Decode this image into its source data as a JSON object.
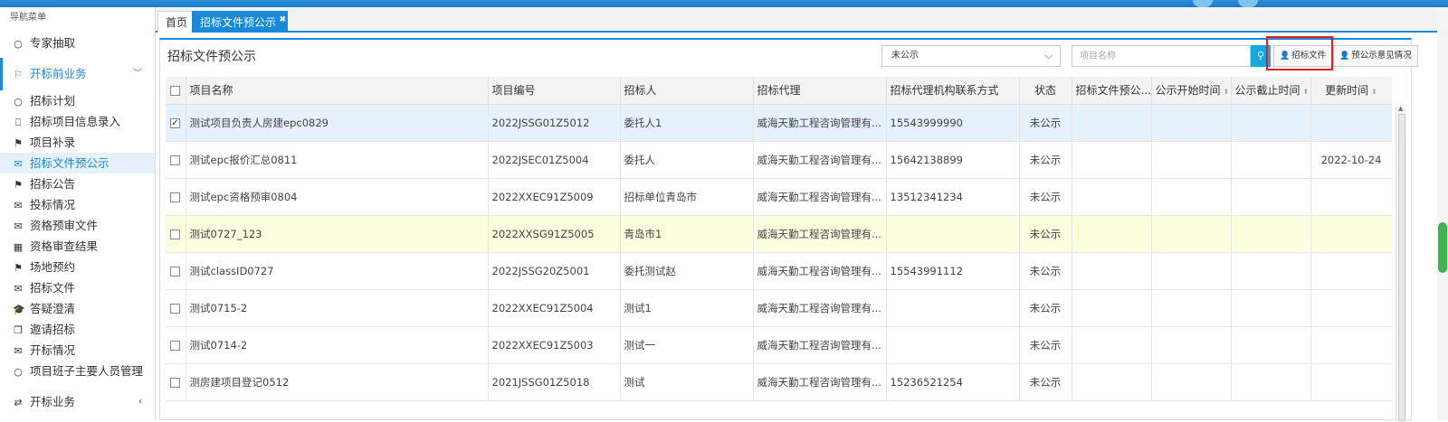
{
  "sidebar": {
    "title": "导航菜单",
    "top_item": {
      "label": "专家抽取",
      "icon": "circle-icon"
    },
    "group": {
      "label": "开标前业务",
      "icon": "flag-outline-icon",
      "expanded": true
    },
    "items": [
      {
        "label": "招标计划",
        "icon": "circle-icon"
      },
      {
        "label": "招标项目信息录入",
        "icon": "bookmark-icon"
      },
      {
        "label": "项目补录",
        "icon": "flag-icon"
      },
      {
        "label": "招标文件预公示",
        "icon": "envelope-icon",
        "active": true
      },
      {
        "label": "招标公告",
        "icon": "flag-icon"
      },
      {
        "label": "投标情况",
        "icon": "envelope-icon"
      },
      {
        "label": "资格预审文件",
        "icon": "envelope-icon"
      },
      {
        "label": "资格审查结果",
        "icon": "calendar-icon"
      },
      {
        "label": "场地预约",
        "icon": "flag-icon"
      },
      {
        "label": "招标文件",
        "icon": "envelope-icon"
      },
      {
        "label": "答疑澄清",
        "icon": "graduation-cap-icon"
      },
      {
        "label": "邀请招标",
        "icon": "copy-icon"
      },
      {
        "label": "开标情况",
        "icon": "envelope-icon"
      },
      {
        "label": "项目班子主要人员管理",
        "icon": "circle-icon"
      }
    ],
    "bottom_group": {
      "label": "开标业务",
      "icon": "exchange-icon"
    }
  },
  "tabs": [
    {
      "label": "首页",
      "active": false
    },
    {
      "label": "招标文件预公示",
      "active": true
    }
  ],
  "panel": {
    "title": "招标文件预公示",
    "status_select": {
      "value": "未公示"
    },
    "search": {
      "placeholder": "项目名称"
    },
    "buttons": {
      "bid_file": "招标文件",
      "opinion": "预公示意见情况"
    }
  },
  "table": {
    "columns": [
      "项目名称",
      "项目编号",
      "招标人",
      "招标代理",
      "招标代理机构联系方式",
      "状态",
      "招标文件预公...",
      "公示开始时间",
      "公示截止时间",
      "更新时间"
    ],
    "rows": [
      {
        "name": "测试项目负责人房建epc0829",
        "code": "2022JSSG01Z5012",
        "tenderer": "委托人1",
        "agency": "威海天勤工程咨询管理有...",
        "contact": "15543999990",
        "status": "未公示",
        "preview": "",
        "start": "",
        "end": "",
        "updated": "",
        "checked": true
      },
      {
        "name": "测试epc报价汇总0811",
        "code": "2022JSEC01Z5004",
        "tenderer": "委托人",
        "agency": "威海天勤工程咨询管理有...",
        "contact": "15642138899",
        "status": "未公示",
        "preview": "",
        "start": "",
        "end": "",
        "updated": "2022-10-24",
        "checked": false
      },
      {
        "name": "测试epc资格预审0804",
        "code": "2022XXEC91Z5009",
        "tenderer": "招标单位青岛市",
        "agency": "威海天勤工程咨询管理有...",
        "contact": "13512341234",
        "status": "未公示",
        "preview": "",
        "start": "",
        "end": "",
        "updated": "",
        "checked": false
      },
      {
        "name": "测试0727_123",
        "code": "2022XXSG91Z5005",
        "tenderer": "青岛市1",
        "agency": "威海天勤工程咨询管理有...",
        "contact": "",
        "status": "未公示",
        "preview": "",
        "start": "",
        "end": "",
        "updated": "",
        "checked": false
      },
      {
        "name": "测试classID0727",
        "code": "2022JSSG20Z5001",
        "tenderer": "委托测试赵",
        "agency": "威海天勤工程咨询管理有...",
        "contact": "15543991112",
        "status": "未公示",
        "preview": "",
        "start": "",
        "end": "",
        "updated": "",
        "checked": false
      },
      {
        "name": "测试0715-2",
        "code": "2022XXEC91Z5004",
        "tenderer": "测试1",
        "agency": "威海天勤工程咨询管理有...",
        "contact": "",
        "status": "未公示",
        "preview": "",
        "start": "",
        "end": "",
        "updated": "",
        "checked": false
      },
      {
        "name": "测试0714-2",
        "code": "2022XXEC91Z5003",
        "tenderer": "测试一",
        "agency": "威海天勤工程咨询管理有...",
        "contact": "",
        "status": "未公示",
        "preview": "",
        "start": "",
        "end": "",
        "updated": "",
        "checked": false
      },
      {
        "name": "测房建项目登记0512",
        "code": "2021JSSG01Z5018",
        "tenderer": "测试",
        "agency": "威海天勤工程咨询管理有...",
        "contact": "15236521254",
        "status": "未公示",
        "preview": "",
        "start": "",
        "end": "",
        "updated": "",
        "checked": false
      }
    ]
  },
  "colors": {
    "accent": "#1a8ad8",
    "selected_row": "#e6f2fb",
    "highlight_row": "#fdfde0",
    "annotation": "#e02020",
    "search_button": "#14a7e0"
  }
}
